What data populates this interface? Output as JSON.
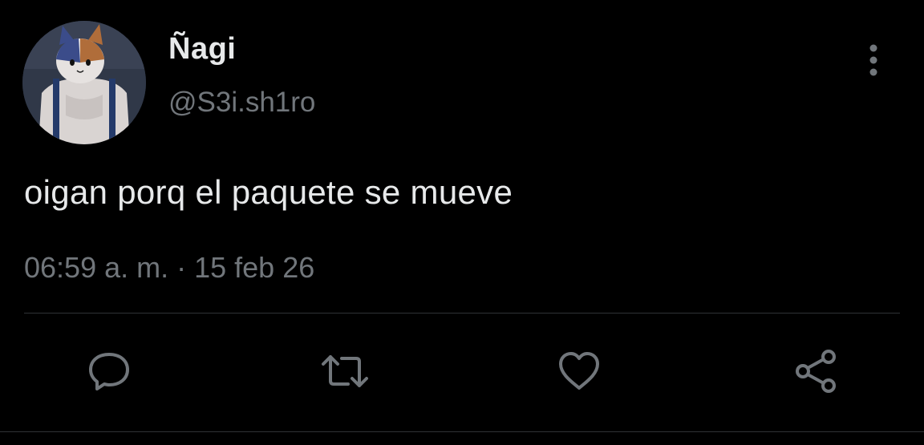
{
  "tweet": {
    "author": {
      "display_name": "Ñagi",
      "handle": "@S3i.sh1ro",
      "avatar_icon": "cat-avatar-icon"
    },
    "text": "oigan porq el paquete se mueve",
    "timestamp": "06:59 a. m. · 15 feb 26"
  },
  "menu": {
    "more_icon": "vertical-dots-icon"
  },
  "actions": [
    {
      "name": "reply",
      "icon": "speech-bubble-icon"
    },
    {
      "name": "retweet",
      "icon": "retweet-icon"
    },
    {
      "name": "like",
      "icon": "heart-icon"
    },
    {
      "name": "share",
      "icon": "share-icon"
    }
  ],
  "colors": {
    "background": "#000000",
    "primary_text": "#e7e9ea",
    "secondary_text": "#71767b",
    "divider": "#2f3336"
  }
}
